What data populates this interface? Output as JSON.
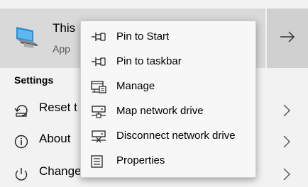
{
  "best_match": {
    "title": "This",
    "subtitle": "App",
    "icon": "computer-icon",
    "open_icon": "arrow-right-icon"
  },
  "settings": {
    "header": "Settings",
    "items": [
      {
        "label": "Reset t",
        "icon": "reset-icon"
      },
      {
        "label": "About",
        "icon": "info-icon"
      },
      {
        "label": "Change when the PC sleeps",
        "icon": "power-icon"
      }
    ]
  },
  "context_menu": {
    "items": [
      {
        "label": "Pin to Start",
        "icon": "pin-icon"
      },
      {
        "label": "Pin to taskbar",
        "icon": "pin-icon"
      },
      {
        "label": "Manage",
        "icon": "manage-icon"
      },
      {
        "label": "Map network drive",
        "icon": "map-drive-icon"
      },
      {
        "label": "Disconnect network drive",
        "icon": "disconnect-drive-icon"
      },
      {
        "label": "Properties",
        "icon": "properties-icon"
      }
    ]
  },
  "colors": {
    "background": "#f2f2f2",
    "selected": "#d9d9d9",
    "arrow_area": "#d0d0d0",
    "menu": "#f7f7f7"
  }
}
